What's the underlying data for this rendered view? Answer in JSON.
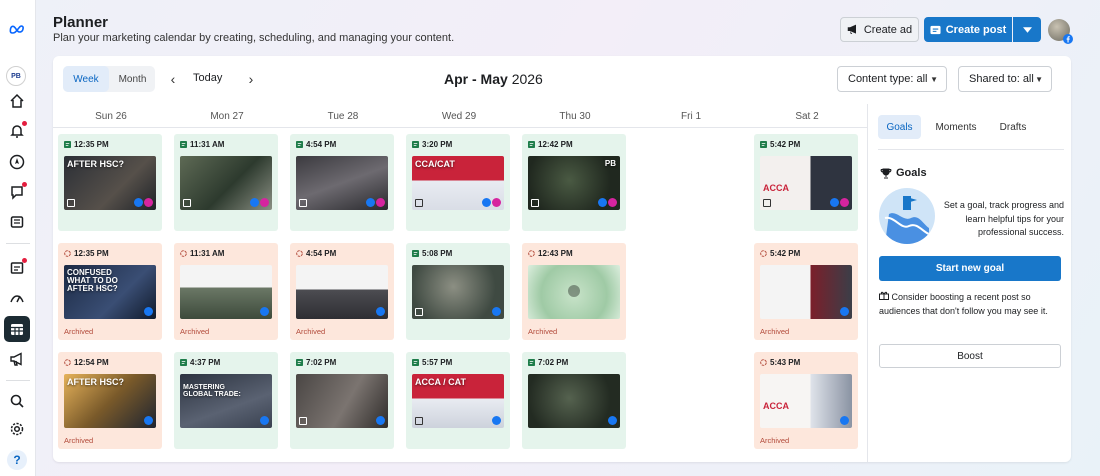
{
  "header": {
    "title": "Planner",
    "subtitle": "Plan your marketing calendar by creating, scheduling, and managing your content.",
    "create_ad_label": "Create ad",
    "create_post_label": "Create post"
  },
  "rail": {
    "page_avatar_text": "PB"
  },
  "toolbar": {
    "view_week": "Week",
    "view_month": "Month",
    "today": "Today",
    "range_bold": "Apr - May",
    "range_year": "2026",
    "content_type_filter": "Content type: all",
    "shared_to_filter": "Shared to: all"
  },
  "days": [
    "Sun 26",
    "Mon 27",
    "Tue 28",
    "Wed 29",
    "Thu 30",
    "Fri 1",
    "Sat 2"
  ],
  "side_panel": {
    "tabs": [
      "Goals",
      "Moments",
      "Drafts"
    ],
    "goals_heading": "Goals",
    "goals_text": "Set a goal, track progress and learn helpful tips for your professional success.",
    "start_goal_label": "Start new goal",
    "boost_tip": "Consider boosting a recent post so audiences that don't follow you may see it.",
    "boost_label": "Boost"
  },
  "posts": {
    "sun_1": {
      "time": "12:35 PM",
      "status": "scheduled",
      "thumb_text": "AFTER HSC?"
    },
    "mon_1": {
      "time": "11:31 AM",
      "status": "scheduled"
    },
    "tue_1": {
      "time": "4:54 PM",
      "status": "scheduled"
    },
    "wed_1": {
      "time": "3:20 PM",
      "status": "scheduled",
      "thumb_text": "CCA/CAT"
    },
    "thu_1": {
      "time": "12:42 PM",
      "status": "scheduled",
      "thumb_text": "PB"
    },
    "sat_1": {
      "time": "5:42 PM",
      "status": "scheduled",
      "thumb_text": "ACCA"
    },
    "sun_2": {
      "time": "12:35 PM",
      "status": "archived",
      "archived_label": "Archived",
      "thumb_text": "CONFUSED WHAT TO DO AFTER HSC?"
    },
    "mon_2": {
      "time": "11:31 AM",
      "status": "archived",
      "archived_label": "Archived"
    },
    "tue_2": {
      "time": "4:54 PM",
      "status": "archived",
      "archived_label": "Archived"
    },
    "wed_2": {
      "time": "5:08 PM",
      "status": "scheduled"
    },
    "thu_2": {
      "time": "12:43 PM",
      "status": "archived",
      "archived_label": "Archived"
    },
    "sat_2": {
      "time": "5:42 PM",
      "status": "archived",
      "archived_label": "Archived"
    },
    "sun_3": {
      "time": "12:54 PM",
      "status": "archived",
      "archived_label": "Archived",
      "thumb_text": "AFTER HSC?"
    },
    "mon_3": {
      "time": "4:37 PM",
      "status": "scheduled",
      "thumb_text": "MASTERING GLOBAL TRADE:"
    },
    "tue_3": {
      "time": "7:02 PM",
      "status": "scheduled"
    },
    "wed_3": {
      "time": "5:57 PM",
      "status": "scheduled",
      "thumb_text": "ACCA / CAT"
    },
    "thu_3": {
      "time": "7:02 PM",
      "status": "scheduled"
    },
    "sat_3": {
      "time": "5:43 PM",
      "status": "archived",
      "archived_label": "Archived",
      "thumb_text": "ACCA"
    }
  },
  "colors": {
    "accent": "#1877c9",
    "scheduled_bg": "#e5f4ec",
    "archived_bg": "#fde7dc",
    "archived_text": "#b24a3a"
  }
}
